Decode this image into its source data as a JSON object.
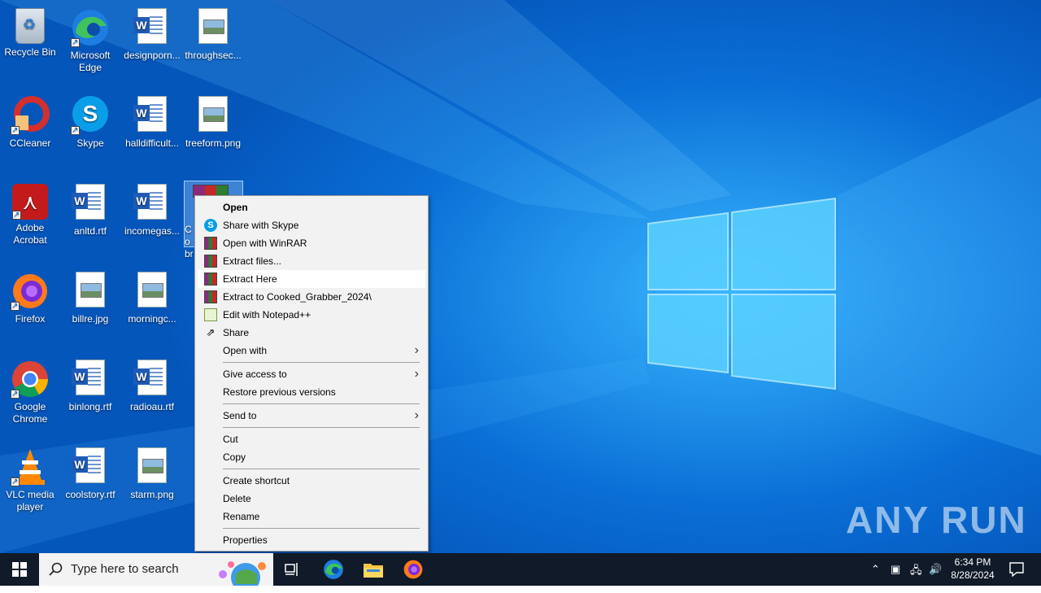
{
  "desktop": {
    "icons": [
      {
        "label": "Recycle Bin",
        "icon": "recycle-bin-icon"
      },
      {
        "label": "Microsoft Edge",
        "icon": "edge-icon"
      },
      {
        "label": "designporn...",
        "icon": "word-document-icon"
      },
      {
        "label": "throughsec...",
        "icon": "image-file-icon"
      },
      {
        "label": "CCleaner",
        "icon": "ccleaner-icon"
      },
      {
        "label": "Skype",
        "icon": "skype-icon"
      },
      {
        "label": "halldifficult...",
        "icon": "word-document-icon"
      },
      {
        "label": "treeform.png",
        "icon": "image-file-icon"
      },
      {
        "label": "Adobe Acrobat",
        "icon": "adobe-acrobat-icon"
      },
      {
        "label": "anltd.rtf",
        "icon": "word-document-icon"
      },
      {
        "label": "incomegas...",
        "icon": "word-document-icon"
      },
      {
        "label": "Co br",
        "icon": "winrar-archive-icon"
      },
      {
        "label": "Firefox",
        "icon": "firefox-icon"
      },
      {
        "label": "billre.jpg",
        "icon": "image-file-icon"
      },
      {
        "label": "morningc...",
        "icon": "image-file-icon"
      },
      {
        "label": "Google Chrome",
        "icon": "chrome-icon"
      },
      {
        "label": "binlong.rtf",
        "icon": "word-document-icon"
      },
      {
        "label": "radioau.rtf",
        "icon": "word-document-icon"
      },
      {
        "label": "VLC media player",
        "icon": "vlc-icon"
      },
      {
        "label": "coolstory.rtf",
        "icon": "word-document-icon"
      },
      {
        "label": "starm.png",
        "icon": "image-file-icon"
      }
    ],
    "watermark": "ANY RUN"
  },
  "context_menu": {
    "items": [
      {
        "label": "Open",
        "icon": "",
        "bold": true
      },
      {
        "label": "Share with Skype",
        "icon": "skype-icon"
      },
      {
        "label": "Open with WinRAR",
        "icon": "winrar-icon"
      },
      {
        "label": "Extract files...",
        "icon": "winrar-icon"
      },
      {
        "label": "Extract Here",
        "icon": "winrar-icon",
        "highlighted": true
      },
      {
        "label": "Extract to Cooked_Grabber_2024\\",
        "icon": "winrar-icon"
      },
      {
        "label": "Edit with Notepad++",
        "icon": "notepad-plus-plus-icon"
      },
      {
        "label": "Share",
        "icon": "share-icon"
      },
      {
        "label": "Open with",
        "submenu": true
      },
      {
        "label": "Give access to",
        "submenu": true
      },
      {
        "label": "Restore previous versions"
      },
      {
        "label": "Send to",
        "submenu": true
      },
      {
        "label": "Cut"
      },
      {
        "label": "Copy"
      },
      {
        "label": "Create shortcut"
      },
      {
        "label": "Delete"
      },
      {
        "label": "Rename"
      },
      {
        "label": "Properties"
      }
    ]
  },
  "taskbar": {
    "search_placeholder": "Type here to search",
    "time": "6:34 PM",
    "date": "8/28/2024"
  }
}
